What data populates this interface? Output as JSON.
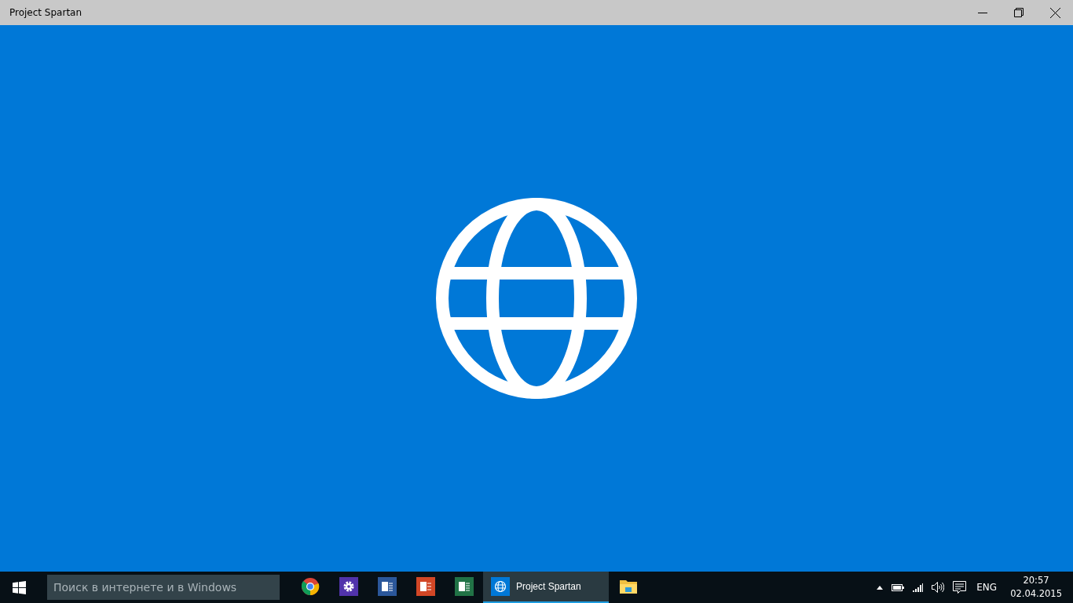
{
  "window": {
    "title": "Project Spartan"
  },
  "taskbar": {
    "search": {
      "placeholder": "Поиск в интернете и в Windows"
    },
    "apps": [
      {
        "kind": "chrome",
        "selected": false
      },
      {
        "kind": "settings",
        "selected": false
      },
      {
        "kind": "word",
        "selected": false
      },
      {
        "kind": "powerpoint",
        "selected": false
      },
      {
        "kind": "excel",
        "selected": false
      },
      {
        "kind": "browser",
        "label": "Project Spartan",
        "selected": true
      },
      {
        "kind": "folder",
        "selected": false
      }
    ],
    "tray": {
      "language": "ENG",
      "time": "20:57",
      "date": "02.04.2015"
    }
  }
}
